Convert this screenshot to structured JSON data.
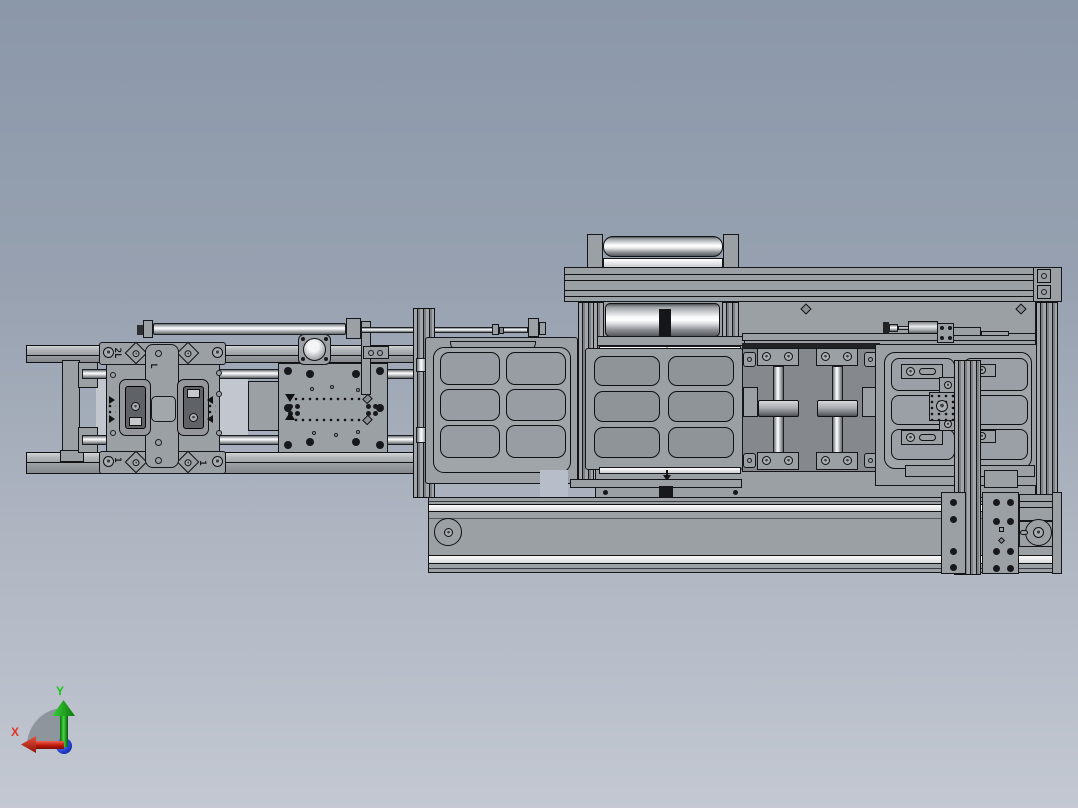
{
  "viewport": {
    "background_top": "#8b98aa",
    "background_bottom": "#c2c7d1",
    "part_color": "#9ba0a5",
    "outline_color": "#111111"
  },
  "marks": {
    "carriage_top": "2L",
    "strap": "L",
    "carriage_bottom_left": "1",
    "carriage_bottom_right": "1"
  },
  "triad": {
    "x_label": "X",
    "y_label": "Y",
    "x_color": "#d92f1f",
    "y_color": "#1fc51f",
    "z_color": "#2340cf"
  }
}
